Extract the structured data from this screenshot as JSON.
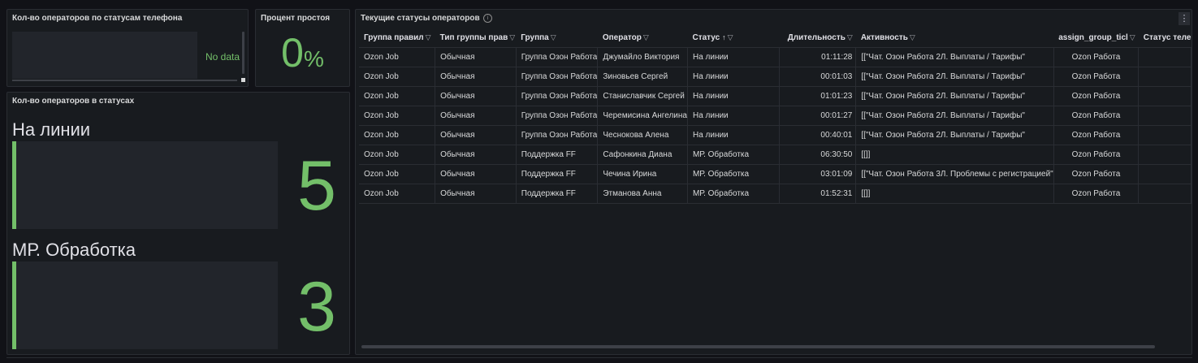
{
  "panel_phone_statuses": {
    "title": "Кол-во операторов по статусам телефона",
    "no_data": "No data"
  },
  "panel_idle": {
    "title": "Процент простоя",
    "value": "0",
    "unit": "%"
  },
  "panel_status_counts": {
    "title": "Кол-во операторов в статусах",
    "items": [
      {
        "label": "На линии",
        "value": "5"
      },
      {
        "label": "МР. Обработка",
        "value": "3"
      }
    ]
  },
  "panel_table": {
    "title": "Текущие статусы операторов",
    "info_icon": "i",
    "menu_icon": "⋮",
    "columns": [
      "Группа правил",
      "Тип группы прав",
      "Группа",
      "Оператор",
      "Статус",
      "Длительность",
      "Активность",
      "assign_group_ticl",
      "Статус теле"
    ],
    "rows": [
      [
        "Ozon Job",
        "Обычная",
        "Группа Озон Работа",
        "Джумайло Виктория",
        "На линии",
        "01:11:28",
        "[[\"Чат. Озон Работа 2Л. Выплаты / Тарифы\"",
        "Ozon Работа",
        ""
      ],
      [
        "Ozon Job",
        "Обычная",
        "Группа Озон Работа",
        "Зиновьев Сергей",
        "На линии",
        "00:01:03",
        "[[\"Чат. Озон Работа 2Л. Выплаты / Тарифы\"",
        "Ozon Работа",
        ""
      ],
      [
        "Ozon Job",
        "Обычная",
        "Группа Озон Работа",
        "Станиславчик Сергей",
        "На линии",
        "01:01:23",
        "[[\"Чат. Озон Работа 2Л. Выплаты / Тарифы\"",
        "Ozon Работа",
        ""
      ],
      [
        "Ozon Job",
        "Обычная",
        "Группа Озон Работа",
        "Черемисина Ангелина",
        "На линии",
        "00:01:27",
        "[[\"Чат. Озон Работа 2Л. Выплаты / Тарифы\"",
        "Ozon Работа",
        ""
      ],
      [
        "Ozon Job",
        "Обычная",
        "Группа Озон Работа",
        "Чеснокова Алена",
        "На линии",
        "00:40:01",
        "[[\"Чат. Озон Работа 2Л. Выплаты / Тарифы\"",
        "Ozon Работа",
        ""
      ],
      [
        "Ozon Job",
        "Обычная",
        "Поддержка FF",
        "Сафонкина Диана",
        "МР. Обработка",
        "06:30:50",
        "[[]]",
        "Ozon Работа",
        ""
      ],
      [
        "Ozon Job",
        "Обычная",
        "Поддержка FF",
        "Чечина Ирина",
        "МР. Обработка",
        "03:01:09",
        "[[\"Чат. Озон Работа 3Л. Проблемы с регистрацией\"",
        "Ozon Работа",
        ""
      ],
      [
        "Ozon Job",
        "Обычная",
        "Поддержка FF",
        "Этманова Анна",
        "МР. Обработка",
        "01:52:31",
        "[[]]",
        "Ozon Работа",
        ""
      ]
    ]
  },
  "colors": {
    "accent_green": "#73bf69",
    "panel_bg": "#181b1f",
    "page_bg": "#111217"
  },
  "icons": {
    "filter": "filter-icon",
    "sort": "sort-ascending-icon",
    "info": "info-icon",
    "menu": "kebab-menu-icon"
  }
}
